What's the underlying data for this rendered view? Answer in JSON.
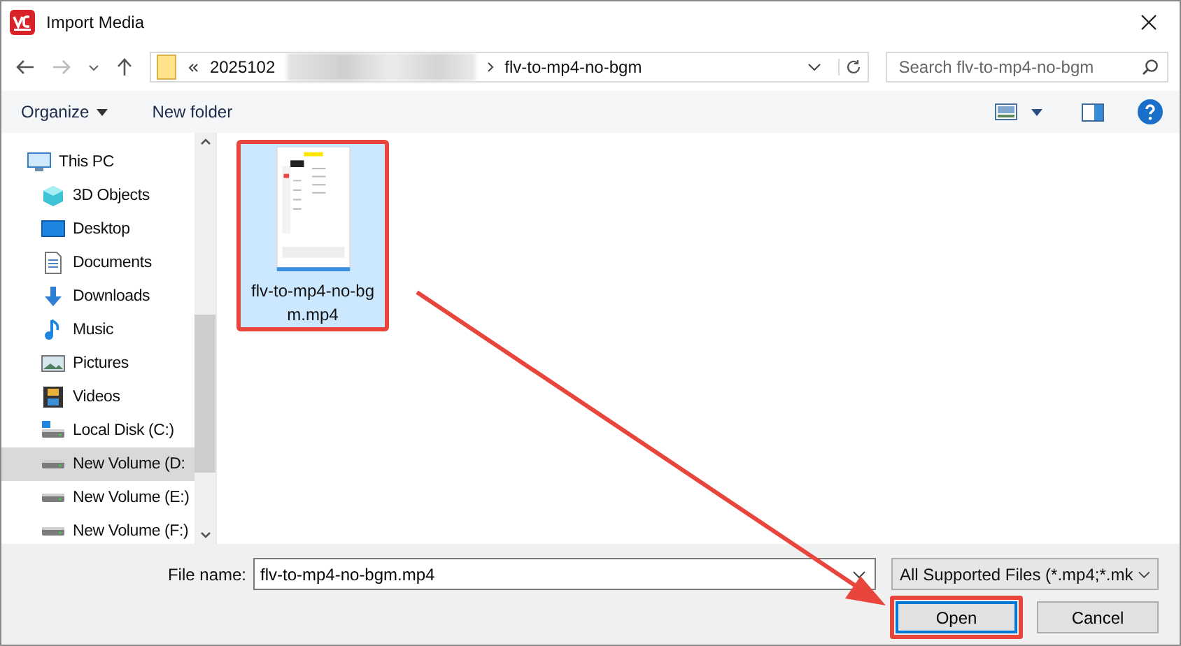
{
  "window": {
    "title": "Import Media"
  },
  "address_bar": {
    "path_start": "2025102",
    "current_folder": "flv-to-mp4-no-bgm"
  },
  "search": {
    "placeholder": "Search flv-to-mp4-no-bgm"
  },
  "toolbar": {
    "organize": "Organize",
    "new_folder": "New folder"
  },
  "sidebar": {
    "items": [
      {
        "label": "This PC",
        "kind": "pc",
        "selected": false,
        "children": [
          {
            "label": "3D Objects",
            "kind": "objects",
            "selected": false
          },
          {
            "label": "Desktop",
            "kind": "desktop",
            "selected": false
          },
          {
            "label": "Documents",
            "kind": "documents",
            "selected": false
          },
          {
            "label": "Downloads",
            "kind": "downloads",
            "selected": false
          },
          {
            "label": "Music",
            "kind": "music",
            "selected": false
          },
          {
            "label": "Pictures",
            "kind": "pictures",
            "selected": false
          },
          {
            "label": "Videos",
            "kind": "videos",
            "selected": false
          },
          {
            "label": "Local Disk (C:)",
            "kind": "system-disk",
            "selected": false
          },
          {
            "label": "New Volume (D:",
            "kind": "disk",
            "selected": true
          },
          {
            "label": "New Volume (E:)",
            "kind": "disk",
            "selected": false
          },
          {
            "label": "New Volume (F:)",
            "kind": "disk",
            "selected": false
          }
        ]
      }
    ]
  },
  "files": [
    {
      "name": "flv-to-mp4-no-bgm.mp4",
      "selected": true
    }
  ],
  "file_name": {
    "label": "File name:",
    "value": "flv-to-mp4-no-bgm.mp4"
  },
  "file_type": {
    "value": "All Supported Files (*.mp4;*.mk"
  },
  "buttons": [
    {
      "label": "Open",
      "kind": "primary"
    },
    {
      "label": "Cancel",
      "kind": "secondary"
    }
  ]
}
